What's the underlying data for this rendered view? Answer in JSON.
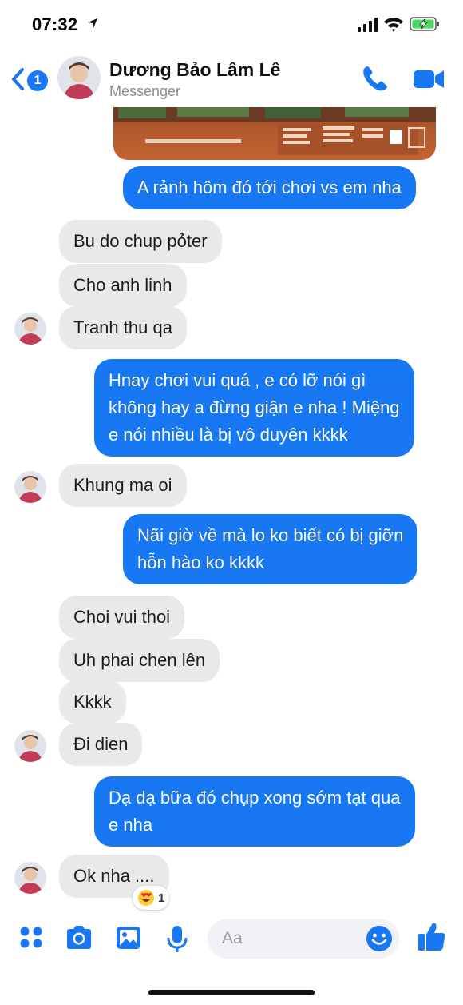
{
  "status_bar": {
    "time": "07:32"
  },
  "header": {
    "back_count": "1",
    "contact_name": "Dương Bảo Lâm Lê",
    "subtitle": "Messenger"
  },
  "messages": [
    {
      "side": "out",
      "text": "A rảnh hôm đó tới chơi vs em nha"
    },
    {
      "side": "in",
      "text": "Bu do chup pỏter"
    },
    {
      "side": "in",
      "text": "Cho anh linh"
    },
    {
      "side": "in",
      "text": "Tranh thu qa"
    },
    {
      "side": "out",
      "text_lines": [
        "Hnay chơi vui quá , e có lỡ nói gì",
        "không hay a đừng giận e nha ! Miệng",
        "e nói nhiều là bị vô duyên kkkk"
      ]
    },
    {
      "side": "in",
      "text": "Khung ma oi"
    },
    {
      "side": "out",
      "text_lines": [
        "Nãi giờ về mà lo ko biết có bị giỡn",
        "hỗn hào ko kkkk"
      ]
    },
    {
      "side": "in",
      "text": "Choi vui thoi"
    },
    {
      "side": "in",
      "text": "Uh phai chen lên"
    },
    {
      "side": "in",
      "text": "Kkkk"
    },
    {
      "side": "in",
      "text": "Đi dien"
    },
    {
      "side": "out",
      "text_lines": [
        "Dạ dạ bữa đó chụp xong sớm tạt qua",
        "e nha"
      ]
    },
    {
      "side": "in",
      "text": "Ok nha ...."
    }
  ],
  "reaction": {
    "emoji": "heart-eyes",
    "count": "1"
  },
  "composer": {
    "placeholder": "Aa"
  },
  "colors": {
    "accent": "#1877f2",
    "incoming_bubble": "#e9e9eb"
  }
}
